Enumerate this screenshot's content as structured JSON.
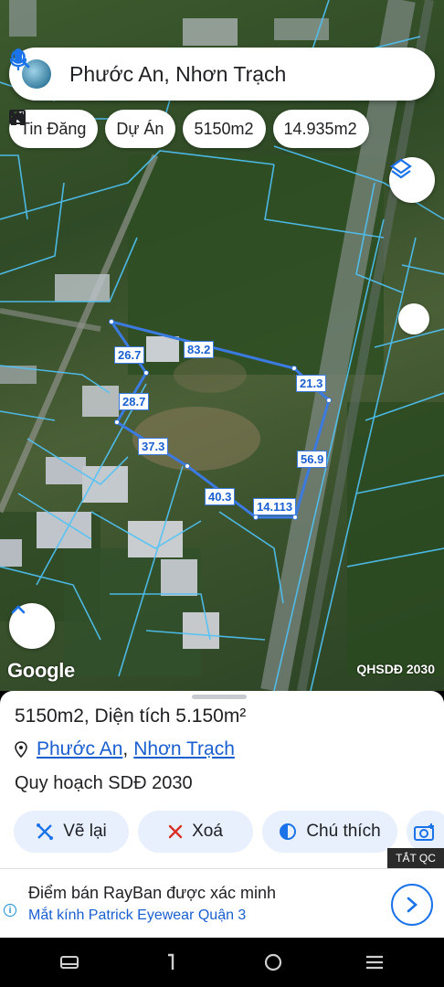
{
  "search": {
    "text": "Phước An, Nhơn Trạch"
  },
  "chips": [
    {
      "label": "Tin Đăng",
      "icon": "news-icon"
    },
    {
      "label": "Dự Án",
      "icon": "house-icon"
    },
    {
      "label": "5150m2",
      "icon": "measure-icon"
    },
    {
      "label": "14.935m2",
      "icon": "measure-icon"
    }
  ],
  "map": {
    "segments": [
      "26.7",
      "83.2",
      "21.3",
      "28.7",
      "37.3",
      "56.9",
      "40.3",
      "14.113"
    ],
    "attribution": "Google",
    "overlay_label": "QHSDĐ 2030"
  },
  "sheet": {
    "title": "5150m2, Diện tích 5.150m²",
    "location": {
      "ward": "Phước An",
      "district": "Nhơn Trạch",
      "separator": ","
    },
    "plan": "Quy hoạch SDĐ 2030",
    "actions": [
      {
        "label": "Vẽ lại",
        "icon": "redraw-icon"
      },
      {
        "label": "Xoá",
        "icon": "close-icon"
      },
      {
        "label": "Chú thích",
        "icon": "legend-icon"
      },
      {
        "label": "",
        "icon": "camera-add-icon"
      }
    ]
  },
  "ad": {
    "tag": "TẮT QC",
    "info": "i",
    "title": "Điểm bán RayBan được xác minh",
    "subtitle": "Mắt kính Patrick Eyewear Quận 3"
  },
  "colors": {
    "accent": "#1a73e8",
    "chip_bg": "#e8f0fe",
    "plot_line": "#3b7ae0",
    "parcel_line": "#4fc3f7"
  }
}
